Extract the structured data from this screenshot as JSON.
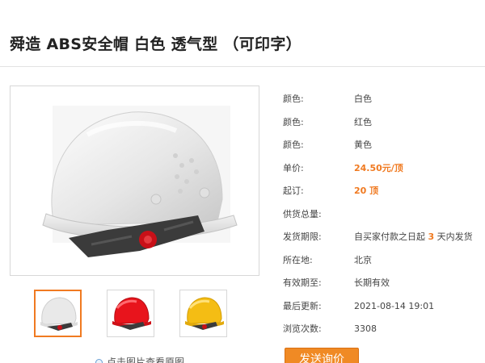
{
  "product": {
    "title": "舜造 ABS安全帽 白色 透气型 （可印字）"
  },
  "gallery": {
    "main_image": "white-helmet",
    "thumbnails": [
      {
        "name": "white-helmet-thumb",
        "color": "#e9e9e9",
        "active": true
      },
      {
        "name": "red-helmet-thumb",
        "color": "#e8141c",
        "active": false
      },
      {
        "name": "yellow-helmet-thumb",
        "color": "#f4bd14",
        "active": false
      }
    ],
    "view_hint": "点击图片查看原图"
  },
  "specs": [
    {
      "label": "颜色:",
      "value": "白色"
    },
    {
      "label": "颜色:",
      "value": "红色"
    },
    {
      "label": "颜色:",
      "value": "黄色"
    },
    {
      "label": "单价:",
      "value": "24.50元/顶"
    },
    {
      "label": "起订:",
      "value": "20 顶"
    },
    {
      "label": "供货总量:",
      "value": ""
    },
    {
      "label": "发货期限:",
      "value_prefix": "自买家付款之日起",
      "value_highlight": "3",
      "value_suffix": "天内发货"
    },
    {
      "label": "所在地:",
      "value": "北京"
    },
    {
      "label": "有效期至:",
      "value": "长期有效"
    },
    {
      "label": "最后更新:",
      "value": "2021-08-14 19:01"
    },
    {
      "label": "浏览次数:",
      "value": "3308"
    }
  ],
  "actions": {
    "inquiry_label": "发送询价"
  },
  "colors": {
    "accent": "#f07a21",
    "button": "#f08a24"
  }
}
